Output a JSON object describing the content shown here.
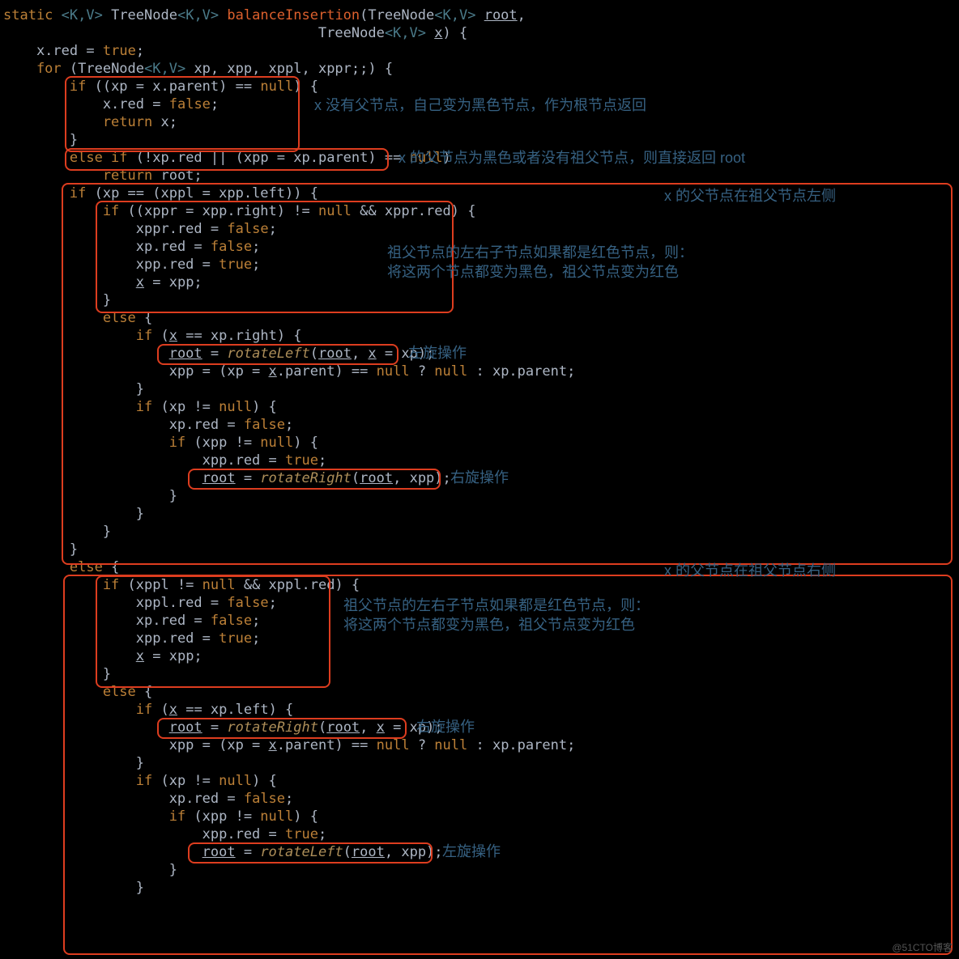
{
  "code": {
    "l1a": "static ",
    "l1b": "<K,V> ",
    "l1c": "TreeNode",
    "l1d": "<K,V> ",
    "l1e": "balanceInsertion",
    "l1f": "(TreeNode",
    "l1g": "<K,V> ",
    "l1h": "root",
    "l1i": ",",
    "l2a": "                                      TreeNode",
    "l2b": "<K,V> ",
    "l2c": "x",
    "l2d": ") {",
    "l3a": "    x.",
    "l3b": "red",
    "l3c": " = ",
    "l3d": "true",
    "l3e": ";",
    "l4a": "    for ",
    "l4b": "(TreeNode",
    "l4c": "<K,V> ",
    "l4d": "xp, xpp, xppl, xppr;;) {",
    "l5a": "        if ",
    "l5b": "((xp = x.",
    "l5c": "parent",
    "l5d": ") == ",
    "l5e": "null",
    "l5f": ") {",
    "l6a": "            x.",
    "l6b": "red",
    "l6c": " = ",
    "l6d": "false",
    "l6e": ";",
    "l7a": "            return ",
    "l7b": "x;",
    "l8": "        }",
    "l9a": "        else if ",
    "l9b": "(!xp.",
    "l9c": "red",
    "l9d": " || (xpp = xp.",
    "l9e": "parent",
    "l9f": ") == ",
    "l9g": "null",
    "l9h": ")",
    "l10a": "            return ",
    "l10b": "root;",
    "l11a": "        if ",
    "l11b": "(xp == (xppl = xpp.",
    "l11c": "left",
    "l11d": ")) {",
    "l12a": "            if ",
    "l12b": "((xppr = xpp.",
    "l12c": "right",
    "l12d": ") != ",
    "l12e": "null",
    "l12f": " && xppr.",
    "l12g": "red",
    "l12h": ") {",
    "l13a": "                xppr.",
    "l13b": "red",
    "l13c": " = ",
    "l13d": "false",
    "l13e": ";",
    "l14a": "                xp.",
    "l14b": "red",
    "l14c": " = ",
    "l14d": "false",
    "l14e": ";",
    "l15a": "                xpp.",
    "l15b": "red",
    "l15c": " = ",
    "l15d": "true",
    "l15e": ";",
    "l16a": "                ",
    "l16b": "x",
    "l16c": " = xpp;",
    "l17": "            }",
    "l18a": "            else ",
    "l18b": "{",
    "l19a": "                if ",
    "l19b": "(",
    "l19c": "x",
    "l19d": " == xp.",
    "l19e": "right",
    "l19f": ") {",
    "l20a": "                    ",
    "l20b": "root",
    "l20c": " = ",
    "l20d": "rotateLeft",
    "l20e": "(",
    "l20f": "root",
    "l20g": ", ",
    "l20h": "x",
    "l20i": " = xp);",
    "l21a": "                    xpp = (xp = ",
    "l21b": "x",
    "l21c": ".",
    "l21d": "parent",
    "l21e": ") == ",
    "l21f": "null",
    "l21g": " ? ",
    "l21h": "null",
    "l21i": " : xp.",
    "l21j": "parent",
    "l21k": ";",
    "l22": "                }",
    "l23a": "                if ",
    "l23b": "(xp != ",
    "l23c": "null",
    "l23d": ") {",
    "l24a": "                    xp.",
    "l24b": "red",
    "l24c": " = ",
    "l24d": "false",
    "l24e": ";",
    "l25a": "                    if ",
    "l25b": "(xpp != ",
    "l25c": "null",
    "l25d": ") {",
    "l26a": "                        xpp.",
    "l26b": "red",
    "l26c": " = ",
    "l26d": "true",
    "l26e": ";",
    "l27a": "                        ",
    "l27b": "root",
    "l27c": " = ",
    "l27d": "rotateRight",
    "l27e": "(",
    "l27f": "root",
    "l27g": ", xpp);",
    "l28": "                    }",
    "l29": "                }",
    "l30": "            }",
    "l31": "        }",
    "l32a": "        else ",
    "l32b": "{",
    "l33a": "            if ",
    "l33b": "(xppl != ",
    "l33c": "null",
    "l33d": " && xppl.",
    "l33e": "red",
    "l33f": ") {",
    "l34a": "                xppl.",
    "l34b": "red",
    "l34c": " = ",
    "l34d": "false",
    "l34e": ";",
    "l35a": "                xp.",
    "l35b": "red",
    "l35c": " = ",
    "l35d": "false",
    "l35e": ";",
    "l36a": "                xpp.",
    "l36b": "red",
    "l36c": " = ",
    "l36d": "true",
    "l36e": ";",
    "l37a": "                ",
    "l37b": "x",
    "l37c": " = xpp;",
    "l38": "            }",
    "l39a": "            else ",
    "l39b": "{",
    "l40a": "                if ",
    "l40b": "(",
    "l40c": "x",
    "l40d": " == xp.",
    "l40e": "left",
    "l40f": ") {",
    "l41a": "                    ",
    "l41b": "root",
    "l41c": " = ",
    "l41d": "rotateRight",
    "l41e": "(",
    "l41f": "root",
    "l41g": ", ",
    "l41h": "x",
    "l41i": " = xp);",
    "l42a": "                    xpp = (xp = ",
    "l42b": "x",
    "l42c": ".",
    "l42d": "parent",
    "l42e": ") == ",
    "l42f": "null",
    "l42g": " ? ",
    "l42h": "null",
    "l42i": " : xp.",
    "l42j": "parent",
    "l42k": ";",
    "l43": "                }",
    "l44a": "                if ",
    "l44b": "(xp != ",
    "l44c": "null",
    "l44d": ") {",
    "l45a": "                    xp.",
    "l45b": "red",
    "l45c": " = ",
    "l45d": "false",
    "l45e": ";",
    "l46a": "                    if ",
    "l46b": "(xpp != ",
    "l46c": "null",
    "l46d": ") {",
    "l47a": "                        xpp.",
    "l47b": "red",
    "l47c": " = ",
    "l47d": "true",
    "l47e": ";",
    "l48a": "                        ",
    "l48b": "root",
    "l48c": " = ",
    "l48d": "rotateLeft",
    "l48e": "(",
    "l48f": "root",
    "l48g": ", xpp);",
    "l49": "                    }",
    "l50": "                }"
  },
  "notes": {
    "n1": "x 没有父节点，自己变为黑色节点，作为根节点返回",
    "n2": "x 的父节点为黑色或者没有祖父节点，则直接返回 root",
    "n3": "x 的父节点在祖父节点左侧",
    "n4": "祖父节点的左右子节点如果都是红色节点，则：\n将这两个节点都变为黑色，祖父节点变为红色",
    "n5": "左旋操作",
    "n6": "右旋操作",
    "n7": "x 的父节点在祖父节点右侧",
    "n8": "祖父节点的左右子节点如果都是红色节点，则：\n将这两个节点都变为黑色，祖父节点变为红色",
    "n9": "右旋操作",
    "n10": "左旋操作"
  },
  "watermark": "@51CTO博客"
}
